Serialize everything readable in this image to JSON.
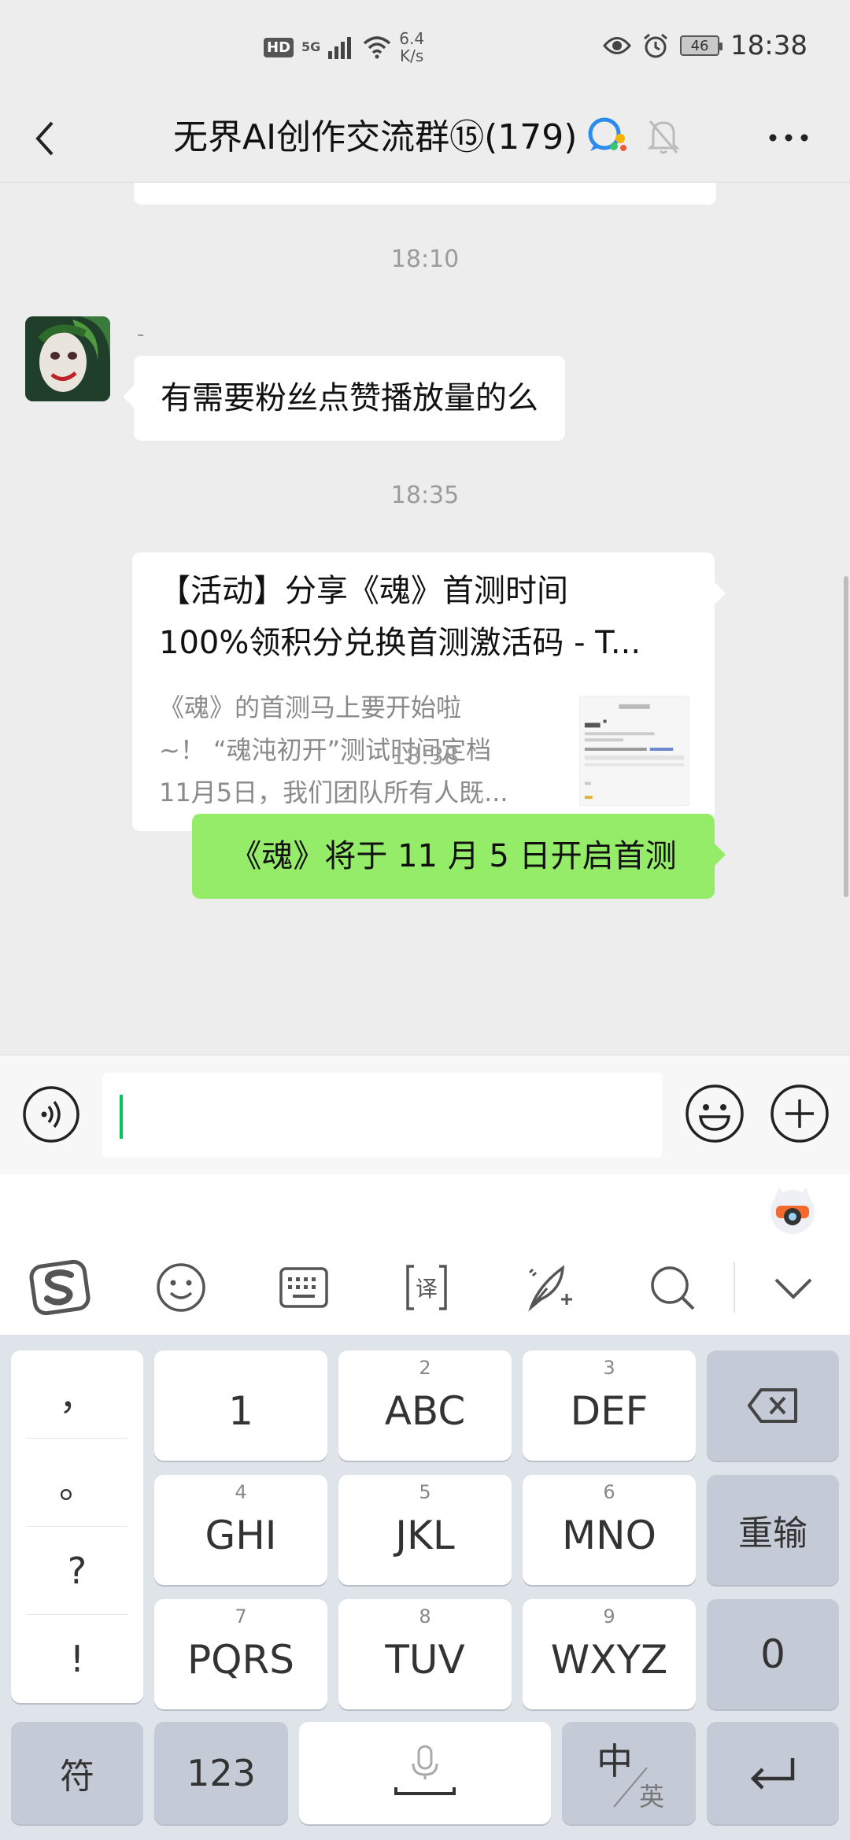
{
  "status_bar": {
    "hd": "HD",
    "network": "5G",
    "speed_value": "6.4",
    "speed_unit": "K/s",
    "battery": "46",
    "time": "18:38"
  },
  "header": {
    "title": "无界AI创作交流群⑮(179)"
  },
  "messages": {
    "time1": "18:10",
    "sender_name": "-",
    "text1": "有需要粉丝点赞播放量的么",
    "time2": "18:35",
    "card": {
      "title_line1": "【活动】分享《魂》首测时间",
      "title_line2": "100%领积分兑换首测激活码 - T...",
      "desc_line1": "《魂》的首测马上要开始啦",
      "desc_line2": "~！ “魂沌初开”测试时间定档",
      "desc_line3": "11月5日，我们团队所有人既..."
    },
    "time3": "18:38",
    "my_text": "《魂》将于 11 月 5 日开启首测"
  },
  "input": {
    "value": ""
  },
  "keyboard": {
    "punct": [
      "，",
      "。",
      "?",
      "!"
    ],
    "row1": [
      {
        "sub": "",
        "main": "1"
      },
      {
        "sub": "2",
        "main": "ABC"
      },
      {
        "sub": "3",
        "main": "DEF"
      }
    ],
    "row2": [
      {
        "sub": "4",
        "main": "GHI"
      },
      {
        "sub": "5",
        "main": "JKL"
      },
      {
        "sub": "6",
        "main": "MNO"
      }
    ],
    "row3": [
      {
        "sub": "7",
        "main": "PQRS"
      },
      {
        "sub": "8",
        "main": "TUV"
      },
      {
        "sub": "9",
        "main": "WXYZ"
      }
    ],
    "reenter": "重输",
    "zero": "0",
    "symbols": "符",
    "num123": "123",
    "lang_main": "中",
    "lang_sub": "英"
  },
  "icons": {
    "accent_green": "#95ec69",
    "caret_green": "#07c160"
  }
}
